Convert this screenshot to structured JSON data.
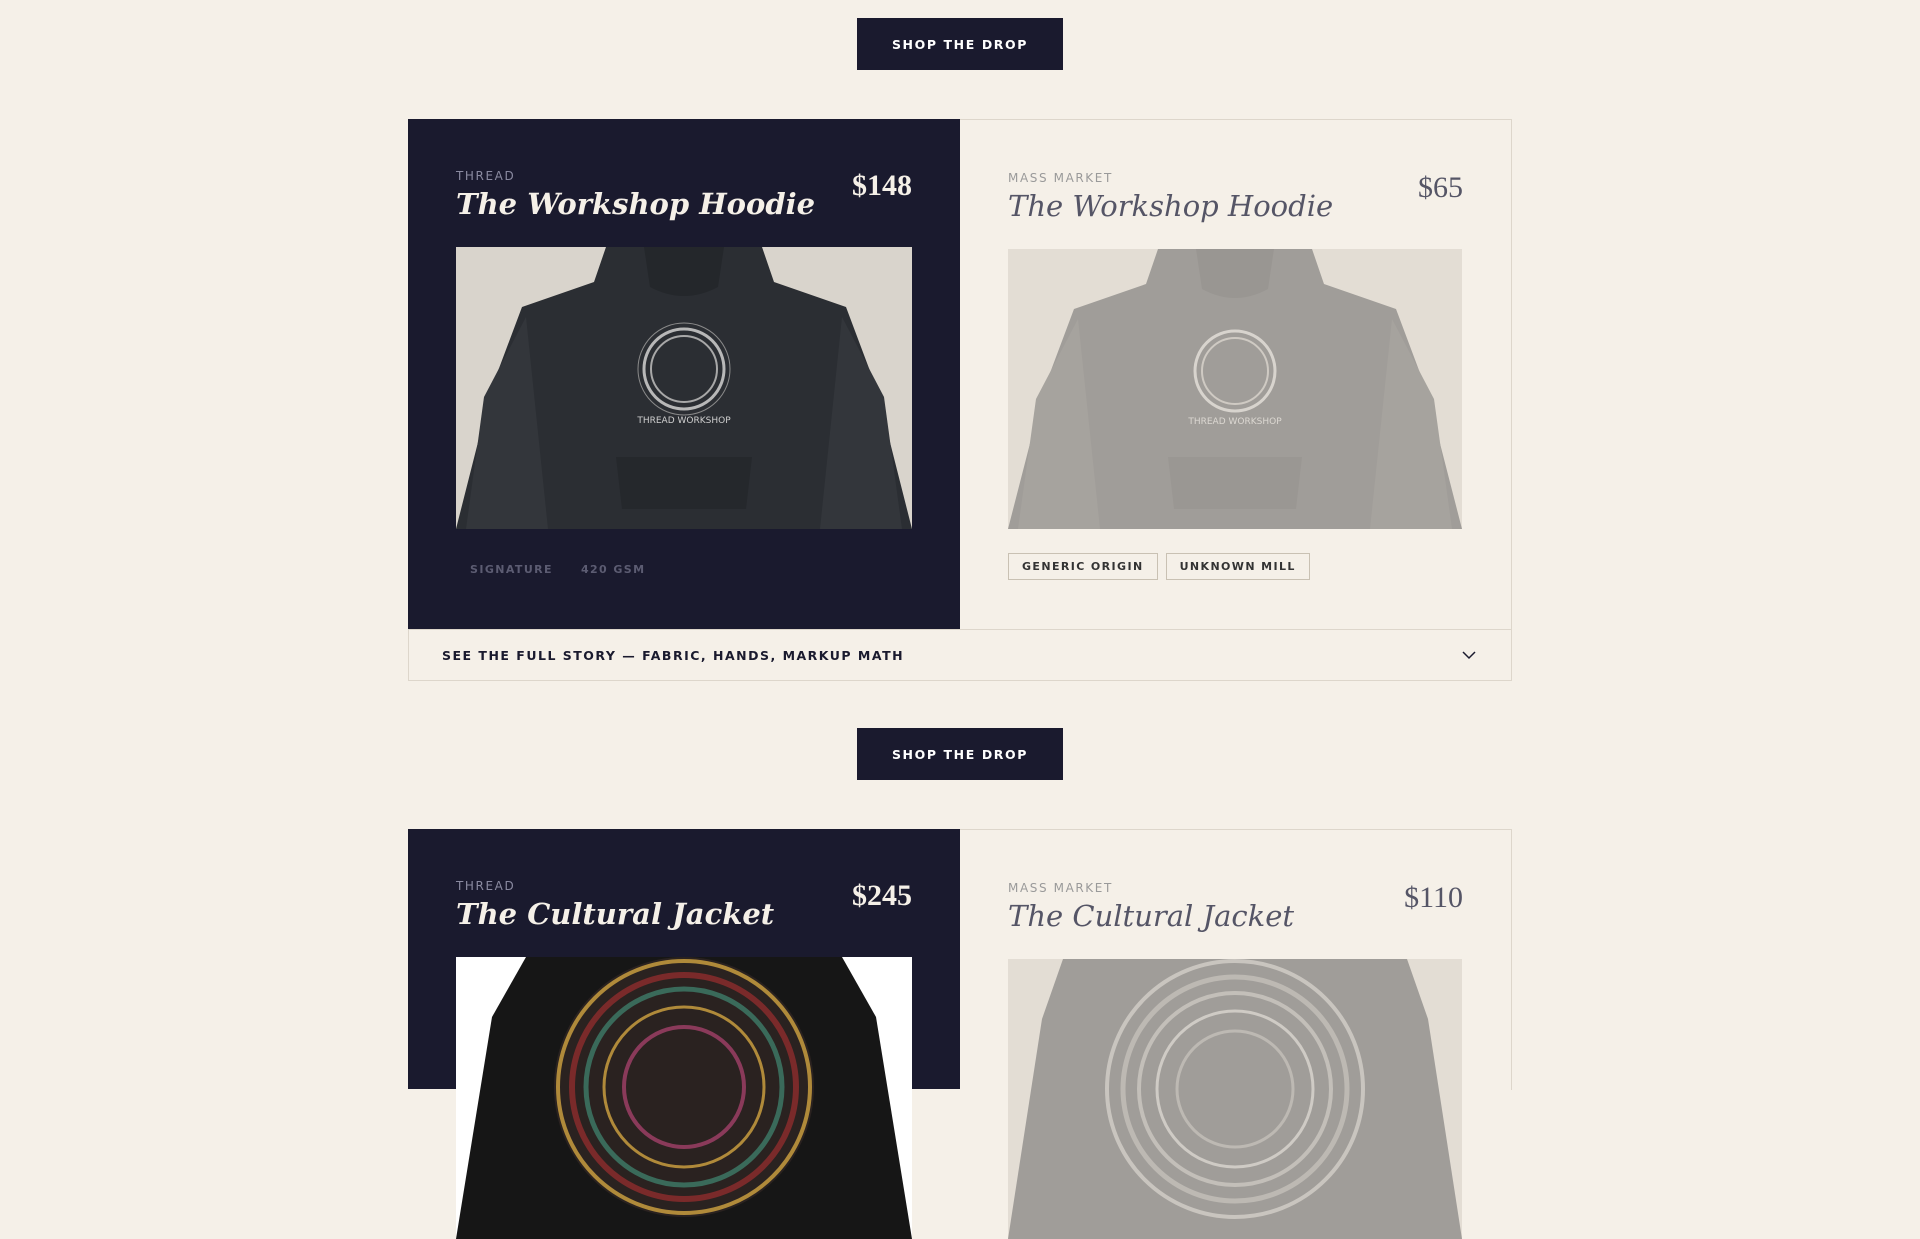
{
  "cta": {
    "label": "SHOP THE DROP"
  },
  "comparisons": [
    {
      "thread": {
        "brand": "THREAD",
        "title": "The Workshop Hoodie",
        "price": "$148",
        "specs": [
          "SIGNATURE",
          "420 GSM"
        ],
        "image_logo_text": "THREAD WORKSHOP"
      },
      "mass": {
        "brand": "MASS MARKET",
        "title": "The Workshop Hoodie",
        "price": "$65",
        "specs": [
          "GENERIC ORIGIN",
          "UNKNOWN MILL"
        ],
        "image_logo_text": "THREAD WORKSHOP"
      },
      "story": "SEE THE FULL STORY — FABRIC, HANDS, MARKUP MATH"
    },
    {
      "thread": {
        "brand": "THREAD",
        "title": "The Cultural Jacket",
        "price": "$245"
      },
      "mass": {
        "brand": "MASS MARKET",
        "title": "The Cultural Jacket",
        "price": "$110"
      }
    }
  ],
  "icons": {
    "story_toggle": "chevron-down-icon"
  },
  "colors": {
    "navy": "#1a1a2e",
    "cream": "#f5f0e8",
    "muted": "#555566"
  }
}
